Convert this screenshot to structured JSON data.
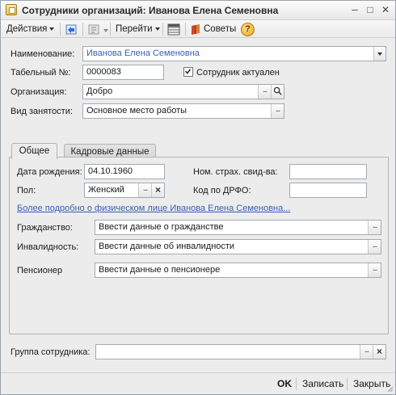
{
  "window": {
    "title": "Сотрудники организаций: Иванова Елена Семеновна",
    "minimize": "–",
    "maximize": "□",
    "close": "✕"
  },
  "toolbar": {
    "actions_label": "Действия",
    "goto_label": "Перейти",
    "tips_label": "Советы",
    "help_symbol": "?"
  },
  "header": {
    "name_label": "Наименование:",
    "name_value": "Иванова Елена Семеновна",
    "tabnum_label": "Табельный №:",
    "tabnum_value": "0000083",
    "active_label": "Сотрудник актуален",
    "active_checked": true,
    "org_label": "Организация:",
    "org_value": "Добро",
    "employment_label": "Вид занятости:",
    "employment_value": "Основное место работы"
  },
  "tabs": [
    {
      "label": "Общее",
      "active": true
    },
    {
      "label": "Кадровые данные",
      "active": false
    }
  ],
  "general": {
    "birth_label": "Дата рождения:",
    "birth_value": "04.10.1960",
    "insurance_label": "Ном. страх. свид-ва:",
    "insurance_value": "",
    "gender_label": "Пол:",
    "gender_value": "Женский",
    "drfo_label": "Код по ДРФО:",
    "drfo_value": "",
    "details_link": "Более подробно о физическом лице Иванова Елена Семеновна...",
    "citizenship_label": "Гражданство:",
    "citizenship_value": "Ввести данные о гражданстве",
    "disability_label": "Инвалидность:",
    "disability_value": "Ввести данные об инвалидности",
    "pensioner_label": "Пенсионер",
    "pensioner_value": "Ввести данные о пенсионере"
  },
  "group": {
    "label": "Группа сотрудника:",
    "value": ""
  },
  "footer": {
    "ok": "OK",
    "save": "Записать",
    "close": "Закрыть"
  },
  "colors": {
    "link": "#3a5fb3",
    "accent_name_text": "#3a5fb3",
    "window_bg": "#ececec"
  }
}
